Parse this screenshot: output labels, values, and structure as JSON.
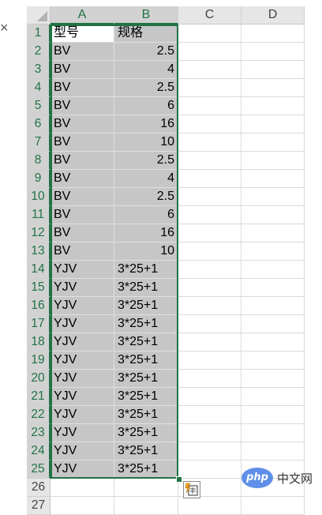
{
  "columns": [
    "A",
    "B",
    "C",
    "D"
  ],
  "rows": [
    {
      "num": "1",
      "a": "型号",
      "b": "规格"
    },
    {
      "num": "2",
      "a": "BV",
      "b": "2.5"
    },
    {
      "num": "3",
      "a": "BV",
      "b": "4"
    },
    {
      "num": "4",
      "a": "BV",
      "b": "2.5"
    },
    {
      "num": "5",
      "a": "BV",
      "b": "6"
    },
    {
      "num": "6",
      "a": "BV",
      "b": "16"
    },
    {
      "num": "7",
      "a": "BV",
      "b": "10"
    },
    {
      "num": "8",
      "a": "BV",
      "b": "2.5"
    },
    {
      "num": "9",
      "a": "BV",
      "b": "4"
    },
    {
      "num": "10",
      "a": "BV",
      "b": "2.5"
    },
    {
      "num": "11",
      "a": "BV",
      "b": "6"
    },
    {
      "num": "12",
      "a": "BV",
      "b": "16"
    },
    {
      "num": "13",
      "a": "BV",
      "b": "10"
    },
    {
      "num": "14",
      "a": "YJV",
      "b": "3*25+1"
    },
    {
      "num": "15",
      "a": "YJV",
      "b": "3*25+1"
    },
    {
      "num": "16",
      "a": "YJV",
      "b": "3*25+1"
    },
    {
      "num": "17",
      "a": "YJV",
      "b": "3*25+1"
    },
    {
      "num": "18",
      "a": "YJV",
      "b": "3*25+1"
    },
    {
      "num": "19",
      "a": "YJV",
      "b": "3*25+1"
    },
    {
      "num": "20",
      "a": "YJV",
      "b": "3*25+1"
    },
    {
      "num": "21",
      "a": "YJV",
      "b": "3*25+1"
    },
    {
      "num": "22",
      "a": "YJV",
      "b": "3*25+1"
    },
    {
      "num": "23",
      "a": "YJV",
      "b": "3*25+1"
    },
    {
      "num": "24",
      "a": "YJV",
      "b": "3*25+1"
    },
    {
      "num": "25",
      "a": "YJV",
      "b": "3*25+1"
    },
    {
      "num": "26",
      "a": "",
      "b": ""
    },
    {
      "num": "27",
      "a": "",
      "b": ""
    }
  ],
  "selection": {
    "range": "A1:B25",
    "active_cell": "A1",
    "selected_columns": [
      "A",
      "B"
    ]
  },
  "colors": {
    "accent": "#217346",
    "selected_fill": "#c6c6c6",
    "header_bg": "#e6e6e6",
    "selected_header_bg": "#d2d2d2"
  },
  "icons": {
    "close": "close-icon",
    "quick_analysis": "quick-analysis-icon"
  },
  "close_glyph": "×",
  "watermark": {
    "badge": "php",
    "text": "中文网"
  }
}
